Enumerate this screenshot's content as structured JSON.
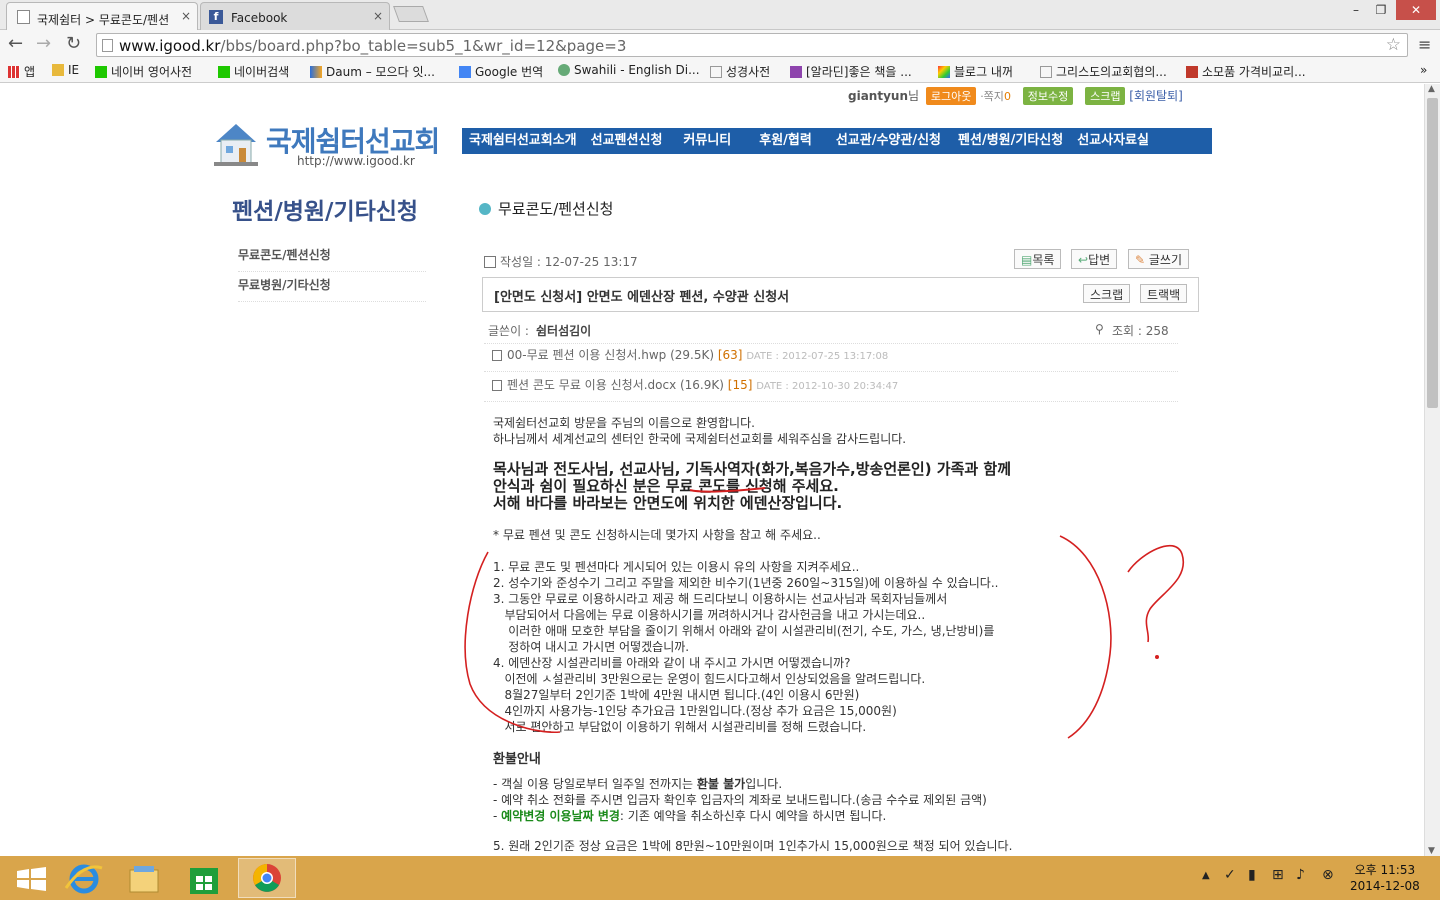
{
  "browser": {
    "tabs": [
      {
        "title": "국제쉼터 > 무료콘도/펜션",
        "close": "×"
      },
      {
        "title": "Facebook",
        "close": "×"
      }
    ],
    "window_controls": {
      "minimize": "–",
      "maximize": "❐",
      "close": "✕"
    },
    "nav": {
      "back": "←",
      "forward": "→",
      "reload": "↻"
    },
    "address": {
      "host": "www.igood.kr",
      "path": "/bbs/board.php?bo_table=sub5_1&wr_id=12&page=3"
    },
    "star": "☆",
    "menu": "≡",
    "bookmarks": [
      "앱",
      "IE",
      "네이버 영어사전",
      "네이버검색",
      "Daum – 모으다 잇...",
      "Google 번역",
      "Swahili - English Di...",
      "성경사전",
      "[알라딘]좋은 책을 ...",
      "블로그 내꺼",
      "그리스도의교회협의...",
      "소모품 가격비교리..."
    ],
    "bookmarks_more": "»"
  },
  "site": {
    "user": {
      "name": "giantyun",
      "suffix": "님",
      "logout": "로그아웃",
      "memo_label": "·쪽지",
      "memo_count": "0",
      "edit_info": "정보수정",
      "scrap": "스크랩",
      "withdraw": "[회원탈퇴]"
    },
    "logo": {
      "name": "국제쉼터선교회",
      "url": "http://www.igood.kr"
    },
    "nav": [
      "국제쉼터선교회소개",
      "선교펜션신청",
      "커뮤니티",
      "후원/협력",
      "선교관/수양관/신청",
      "펜션/병원/기타신청",
      "선교사자료실"
    ],
    "side": {
      "title": "펜션/병원/기타신청",
      "items": [
        "무료콘도/펜션신청",
        "무료병원/기타신청"
      ]
    },
    "board_title": "무료콘도/펜션신청"
  },
  "post": {
    "date_label": "작성일 : 12-07-25 13:17",
    "buttons": {
      "list": "목록",
      "reply": "답변",
      "write": "글쓰기"
    },
    "subject": "[안면도 신청서] 안면도 에덴산장 펜션, 수양관 신청서",
    "subject_buttons": {
      "scrap": "스크랩",
      "trackback": "트랙백"
    },
    "author_label": "글쓴이 : ",
    "author": "쉼터섬김이",
    "views_label": "조회 : 258",
    "files": [
      {
        "name": "00-무료 펜션 이용 신청서.hwp (29.5K)",
        "count": "[63]",
        "date": "DATE : 2012-07-25 13:17:08"
      },
      {
        "name": "펜션 콘도 무료 이용 신청서.docx (16.9K)",
        "count": "[15]",
        "date": "DATE : 2012-10-30 20:34:47"
      }
    ],
    "intro": [
      "국제쉼터선교회 방문을 주님의 이름으로 환영합니다.",
      "하나님께서 세계선교의 센터인 한국에 국제쉼터선교회를 세워주심을 감사드립니다."
    ],
    "highlight": [
      "목사님과 전도사님, 선교사님, 기독사역자(화가,복음가수,방송언론인) 가족과 함께",
      "안식과 쉼이 필요하신 분은 무료 콘도를 신청해 주세요.",
      "서해 바다를 바라보는 안면도에 위치한 에덴산장입니다."
    ],
    "notice": "* 무료 펜션 및 콘도 신청하시는데 몇가지 사항을 참고 해 주세요..",
    "rules": [
      "1. 무료 콘도 및 펜션마다 게시되어 있는 이용시 유의 사항을 지켜주세요..",
      "2. 성수기와 준성수기 그리고 주말을 제외한 비수기(1년중 260일~315일)에 이용하실 수 있습니다..",
      "3. 그동안 무료로 이용하시라고 제공 해 드리다보니 이용하시는 선교사님과 목회자님들께서",
      "   부담되어서 다음에는 무료 이용하시기를 꺼려하시거나 감사헌금을 내고 가시는데요..",
      "    이러한 애매 모호한 부담을 줄이기 위해서 아래와 같이 시설관리비(전기, 수도, 가스, 냉,난방비)를",
      "    정하여 내시고 가시면 어떻겠습니까.",
      "4. 에덴산장 시설관리비를 아래와 같이 내 주시고 가시면 어떻겠습니까?",
      "   이전에 ㅅ설관리비 3만원으로는 운영이 힘드시다고해서 인상되었음을 알려드립니다.",
      "   8월27일부터 2인기준 1박에 4만원 내시면 됩니다.(4인 이용시 6만원)",
      "   4인까지 사용가능-1인당 추가요금 1만원입니다.(정상 추가 요금은 15,000원)",
      "   서로 편안하고 부담없이 이용하기 위해서 시설관리비를 정해 드렸습니다."
    ],
    "refund_title": "환불안내",
    "refund": [
      {
        "a": "- 객실 이용 당일로부터 일주일 전까지는 ",
        "b": "환불 불가",
        "c": "입니다."
      },
      {
        "a": "- 예약 취소 전화를 주시면 입금자 확인후 입금자의 계좌로 보내드립니다.(송금 수수료 제외된 금액)",
        "b": "",
        "c": ""
      },
      {
        "a": "- ",
        "b": "예약변경 이용날짜 변경",
        "c": ": 기존 예약을 취소하신후 다시 예약을 하시면 됩니다."
      }
    ],
    "rule5": "5. 원래 2인기준 정상 요금은 1박에 8만원~10만원이며 1인추가시 15,000원으로 책정 되어 있습니다."
  },
  "taskbar": {
    "clock_time": "오후 11:53",
    "clock_date": "2014-12-08"
  },
  "colors": {
    "nav_bg": "#1e5ea8",
    "logo": "#3f79bd",
    "annotation_red": "#d42020",
    "taskbar": "#d9a54b"
  }
}
